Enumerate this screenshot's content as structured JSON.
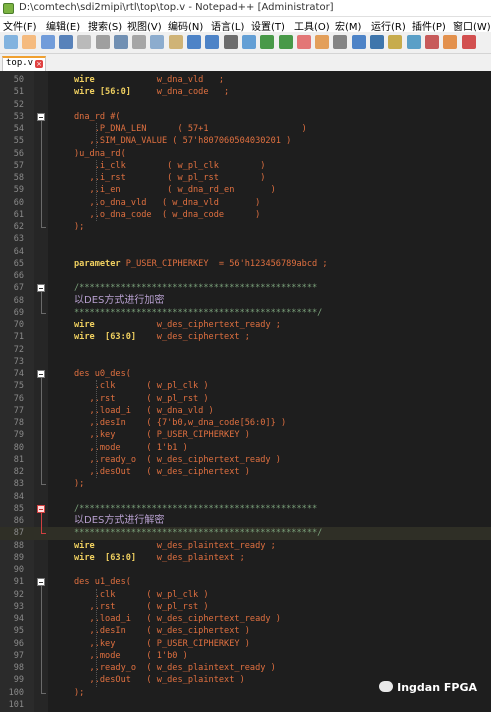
{
  "window": {
    "title": "D:\\comtech\\sdi2mipi\\rtl\\top\\top.v - Notepad++ [Administrator]"
  },
  "menu": [
    "文件(F)",
    "编辑(E)",
    "搜索(S)",
    "视图(V)",
    "编码(N)",
    "语言(L)",
    "设置(T)",
    "工具(O)",
    "宏(M)",
    "运行(R)",
    "插件(P)",
    "窗口(W)"
  ],
  "toolbar": {
    "icons": [
      "new-icon",
      "open-icon",
      "save-icon",
      "save-all-icon",
      "close-icon",
      "close-all-icon",
      "print-icon",
      "cut-icon",
      "copy-icon",
      "paste-icon",
      "undo-icon",
      "redo-icon",
      "find-icon",
      "replace-icon",
      "zoom-in-icon",
      "zoom-out-icon",
      "sync-v-icon",
      "sync-h-icon",
      "word-wrap-icon",
      "all-chars-icon",
      "indent-guide-icon",
      "udl-icon",
      "doc-map-icon",
      "function-list-icon",
      "folder-icon",
      "record-icon"
    ]
  },
  "tab": {
    "label": "top.v"
  },
  "editor": {
    "lines": [
      {
        "n": "50",
        "segs": [
          [
            "kw",
            "wire"
          ],
          [
            "",
            "            w_dna_vld   ;"
          ]
        ]
      },
      {
        "n": "51",
        "segs": [
          [
            "kw",
            "wire [56:0]"
          ],
          [
            "",
            "     w_dna_code   ;"
          ]
        ]
      },
      {
        "n": "52",
        "segs": []
      },
      {
        "n": "53",
        "segs": [
          [
            "",
            "dna_rd #("
          ]
        ]
      },
      {
        "n": "54",
        "segs": [
          [
            "",
            "    .P_DNA_LEN      ( 57+1                  )"
          ]
        ]
      },
      {
        "n": "55",
        "segs": [
          [
            "",
            "   ,.SIM_DNA_VALUE ( 57'h807060504030201 )"
          ]
        ]
      },
      {
        "n": "56",
        "segs": [
          [
            "",
            ")u_dna_rd("
          ]
        ]
      },
      {
        "n": "57",
        "segs": [
          [
            "",
            "    .i_clk        ( w_pl_clk        )"
          ]
        ]
      },
      {
        "n": "58",
        "segs": [
          [
            "",
            "   ,.i_rst        ( w_pl_rst        )"
          ]
        ]
      },
      {
        "n": "59",
        "segs": [
          [
            "",
            "   ,.i_en         ( w_dna_rd_en       )"
          ]
        ]
      },
      {
        "n": "60",
        "segs": [
          [
            "",
            "   ,.o_dna_vld   ( w_dna_vld       )"
          ]
        ]
      },
      {
        "n": "61",
        "segs": [
          [
            "",
            "   ,.o_dna_code  ( w_dna_code      )"
          ]
        ]
      },
      {
        "n": "62",
        "segs": [
          [
            "",
            ");"
          ]
        ]
      },
      {
        "n": "63",
        "segs": []
      },
      {
        "n": "64",
        "segs": []
      },
      {
        "n": "65",
        "segs": [
          [
            "kw",
            "parameter"
          ],
          [
            "",
            " P_USER_CIPHERKEY  = 56'h123456789abcd ;"
          ]
        ]
      },
      {
        "n": "66",
        "segs": []
      },
      {
        "n": "67",
        "segs": [
          [
            "cm",
            "/**********************************************"
          ]
        ]
      },
      {
        "n": "68",
        "segs": [
          [
            "cm cn",
            "以DES方式进行加密"
          ]
        ]
      },
      {
        "n": "69",
        "segs": [
          [
            "cm",
            "***********************************************/"
          ]
        ]
      },
      {
        "n": "70",
        "segs": [
          [
            "kw",
            "wire"
          ],
          [
            "",
            "            w_des_ciphertext_ready ;"
          ]
        ]
      },
      {
        "n": "71",
        "segs": [
          [
            "kw",
            "wire  [63:0]"
          ],
          [
            "",
            "    w_des_ciphertext ;"
          ]
        ]
      },
      {
        "n": "72",
        "segs": []
      },
      {
        "n": "73",
        "segs": []
      },
      {
        "n": "74",
        "segs": [
          [
            "",
            "des u0_des("
          ]
        ]
      },
      {
        "n": "75",
        "segs": [
          [
            "",
            "    .clk      ( w_pl_clk )"
          ]
        ]
      },
      {
        "n": "76",
        "segs": [
          [
            "",
            "   ,.rst      ( w_pl_rst )"
          ]
        ]
      },
      {
        "n": "77",
        "segs": [
          [
            "",
            "   ,.load_i   ( w_dna_vld )"
          ]
        ]
      },
      {
        "n": "78",
        "segs": [
          [
            "",
            "   ,.desIn    ( {7'b0,w_dna_code[56:0]} )"
          ]
        ]
      },
      {
        "n": "79",
        "segs": [
          [
            "",
            "   ,.key      ( P_USER_CIPHERKEY )"
          ]
        ]
      },
      {
        "n": "80",
        "segs": [
          [
            "",
            "   ,.mode     ( 1'b1 )"
          ]
        ]
      },
      {
        "n": "81",
        "segs": [
          [
            "",
            "   ,.ready_o  ( w_des_ciphertext_ready )"
          ]
        ]
      },
      {
        "n": "82",
        "segs": [
          [
            "",
            "   ,.desOut   ( w_des_ciphertext )"
          ]
        ]
      },
      {
        "n": "83",
        "segs": [
          [
            "",
            ");"
          ]
        ]
      },
      {
        "n": "84",
        "segs": []
      },
      {
        "n": "85",
        "segs": [
          [
            "cm",
            "/**********************************************"
          ]
        ]
      },
      {
        "n": "86",
        "segs": [
          [
            "cm cn",
            "以DES方式进行解密"
          ]
        ]
      },
      {
        "n": "87",
        "segs": [
          [
            "cm",
            "***********************************************/"
          ]
        ]
      },
      {
        "n": "88",
        "segs": [
          [
            "kw",
            "wire"
          ],
          [
            "",
            "            w_des_plaintext_ready ;"
          ]
        ]
      },
      {
        "n": "89",
        "segs": [
          [
            "kw",
            "wire  [63:0]"
          ],
          [
            "",
            "    w_des_plaintext ;"
          ]
        ]
      },
      {
        "n": "90",
        "segs": []
      },
      {
        "n": "91",
        "segs": [
          [
            "",
            "des u1_des("
          ]
        ]
      },
      {
        "n": "92",
        "segs": [
          [
            "",
            "    .clk      ( w_pl_clk )"
          ]
        ]
      },
      {
        "n": "93",
        "segs": [
          [
            "",
            "   ,.rst      ( w_pl_rst )"
          ]
        ]
      },
      {
        "n": "94",
        "segs": [
          [
            "",
            "   ,.load_i   ( w_des_ciphertext_ready )"
          ]
        ]
      },
      {
        "n": "95",
        "segs": [
          [
            "",
            "   ,.desIn    ( w_des_ciphertext )"
          ]
        ]
      },
      {
        "n": "96",
        "segs": [
          [
            "",
            "   ,.key      ( P_USER_CIPHERKEY )"
          ]
        ]
      },
      {
        "n": "97",
        "segs": [
          [
            "",
            "   ,.mode     ( 1'b0 )"
          ]
        ]
      },
      {
        "n": "98",
        "segs": [
          [
            "",
            "   ,.ready_o  ( w_des_plaintext_ready )"
          ]
        ]
      },
      {
        "n": "99",
        "segs": [
          [
            "",
            "   ,.desOut   ( w_des_plaintext )"
          ]
        ]
      },
      {
        "n": "100",
        "segs": [
          [
            "",
            ");"
          ]
        ]
      },
      {
        "n": "101",
        "segs": []
      }
    ],
    "highlighted_line": "87"
  },
  "watermark": "Ingdan FPGA"
}
